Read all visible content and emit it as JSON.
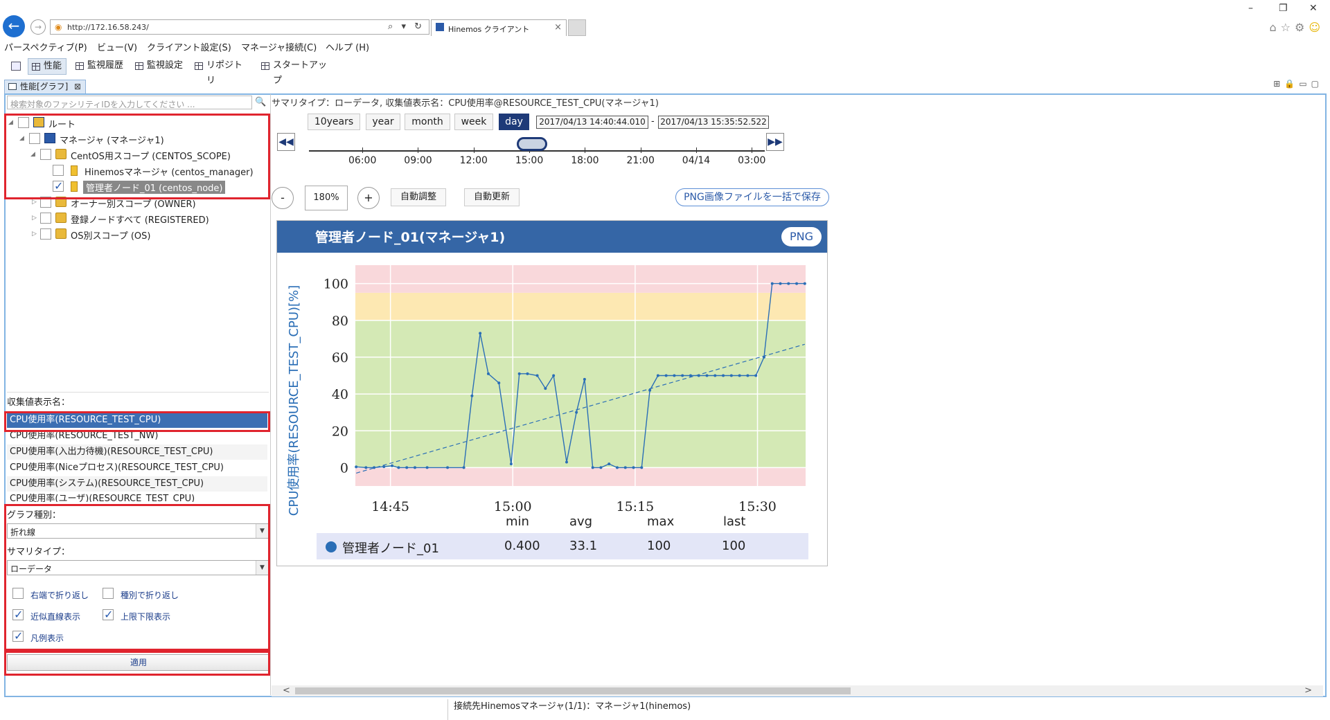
{
  "browser": {
    "url": "http://172.16.58.243/",
    "tab_title": "Hinemos クライアント",
    "tab_close": "×",
    "addr_tools": "⌕ ▾ ↻"
  },
  "menu": [
    "パースペクティブ(P)",
    "ビュー(V)",
    "クライアント設定(S)",
    "マネージャ接続(C)",
    "ヘルプ (H)"
  ],
  "perspectives": [
    "性能",
    "監視履歴",
    "監視設定",
    "リポジトリ",
    "スタートアップ"
  ],
  "view_tab": "性能[グラフ]",
  "view_tab_close": "⊠",
  "left": {
    "search_placeholder": "検索対象のファシリティIDを入力してください ...",
    "search_icon": "🔍",
    "tree": [
      {
        "label": "ルート",
        "checked": false,
        "icon": "scope-root-icon"
      },
      {
        "label": "マネージャ (マネージャ1)",
        "checked": false,
        "icon": "manager-icon"
      },
      {
        "label": "CentOS用スコープ (CENTOS_SCOPE)",
        "checked": false,
        "icon": "folder-icon"
      },
      {
        "label": "Hinemosマネージャ (centos_manager)",
        "checked": false,
        "icon": "node-icon"
      },
      {
        "label": "管理者ノード_01 (centos_node)",
        "checked": true,
        "icon": "node-icon"
      },
      {
        "label": "オーナー別スコープ (OWNER)",
        "checked": false,
        "icon": "folder-icon"
      },
      {
        "label": "登録ノードすべて (REGISTERED)",
        "checked": false,
        "icon": "folder-icon"
      },
      {
        "label": "OS別スコープ (OS)",
        "checked": false,
        "icon": "folder-icon"
      }
    ],
    "collect_label": "収集値表示名：",
    "collect_items": [
      "CPU使用率(RESOURCE_TEST_CPU)",
      "CPU使用率(RESOURCE_TEST_NW)",
      "CPU使用率(入出力待機)(RESOURCE_TEST_CPU)",
      "CPU使用率(Niceプロセス)(RESOURCE_TEST_CPU)",
      "CPU使用率(システム)(RESOURCE_TEST_CPU)",
      "CPU使用率(ユーザ)(RESOURCE_TEST_CPU)"
    ],
    "graph_type_label": "グラフ種別：",
    "graph_type_value": "折れ線",
    "summary_type_label": "サマリタイプ：",
    "summary_type_value": "ローデータ",
    "options": {
      "wrap_right": {
        "label": "右端で折り返し",
        "checked": false
      },
      "wrap_type": {
        "label": "種別で折り返し",
        "checked": false
      },
      "approx_line": {
        "label": "近似直線表示",
        "checked": true
      },
      "limits": {
        "label": "上限下限表示",
        "checked": true
      },
      "legend": {
        "label": "凡例表示",
        "checked": true
      }
    },
    "apply_label": "適用"
  },
  "right": {
    "summary_header": "サマリタイプ：ローデータ,    収集値表示名：CPU使用率@RESOURCE_TEST_CPU(マネージャ1)",
    "ranges": [
      "10years",
      "year",
      "month",
      "week",
      "day"
    ],
    "active_range": "day",
    "date_from": "2017/04/13 14:40:44.010",
    "date_sep": "-",
    "date_to": "2017/04/13 15:35:52.522",
    "timeline_labels": [
      "06:00",
      "09:00",
      "12:00",
      "15:00",
      "18:00",
      "21:00",
      "04/14",
      "03:00"
    ],
    "zoom": "180%",
    "zoom_minus": "-",
    "zoom_plus": "+",
    "auto_adjust": "自動調整",
    "auto_refresh": "自動更新",
    "png_all": "PNG画像ファイルを一括で保存"
  },
  "card": {
    "title": "管理者ノード_01(マネージャ1)",
    "png_label": "PNG",
    "stats_headers": [
      "min",
      "avg",
      "max",
      "last"
    ],
    "legend_name": "管理者ノード_01",
    "stats_values": [
      "0.400",
      "33.1",
      "100",
      "100"
    ]
  },
  "chart_data": {
    "type": "line",
    "ylabel": "CPU使用率(RESOURCE_TEST_CPU)[%]",
    "x_tick_labels": [
      "14:45",
      "15:00",
      "15:15",
      "15:30"
    ],
    "y_tick_labels": [
      "0",
      "20",
      "40",
      "60",
      "80",
      "100"
    ],
    "ylim": [
      -10,
      110
    ],
    "xlim_minutes": [
      40.7,
      95.9
    ],
    "bands": [
      {
        "from": -10,
        "to": 0,
        "color": "#f9d8db"
      },
      {
        "from": 0,
        "to": 80,
        "color": "#d4e9b5"
      },
      {
        "from": 80,
        "to": 95,
        "color": "#fde8b2"
      },
      {
        "from": 95,
        "to": 110,
        "color": "#f9d8db"
      }
    ],
    "series": [
      {
        "name": "管理者ノード_01",
        "color": "#2a6eb6",
        "x_minutes": [
          40.8,
          42.0,
          43.0,
          44.2,
          45.2,
          46.0,
          47.0,
          48.0,
          49.5,
          52.0,
          54.0,
          55.0,
          56.0,
          57.0,
          58.3,
          59.8,
          60.8,
          61.8,
          63.0,
          64.0,
          65.0,
          66.6,
          67.8,
          68.8,
          69.8,
          70.8,
          71.8,
          72.8,
          73.8,
          74.8,
          75.8,
          76.8,
          77.8,
          78.8,
          79.8,
          80.8,
          81.8,
          82.8,
          83.8,
          84.8,
          85.8,
          86.8,
          87.8,
          88.8,
          89.8,
          90.8,
          91.8,
          92.8,
          93.8,
          94.8,
          95.8
        ],
        "values": [
          0.4,
          0,
          0,
          0.5,
          1,
          0,
          0,
          0,
          0,
          0,
          0,
          39,
          73,
          51,
          46,
          2,
          51,
          51,
          50,
          43,
          50,
          3,
          30,
          48,
          0,
          0,
          2,
          0,
          0,
          0,
          0,
          42,
          50,
          50,
          50,
          50,
          50,
          50,
          50,
          50,
          50,
          50,
          50,
          50,
          50,
          60,
          100,
          100,
          100,
          100,
          100
        ]
      }
    ],
    "trend_line": {
      "from": [
        40.8,
        -3
      ],
      "to": [
        95.8,
        67
      ]
    }
  },
  "status": "接続先Hinemosマネージャ(1/1)：マネージャ1(hinemos)"
}
